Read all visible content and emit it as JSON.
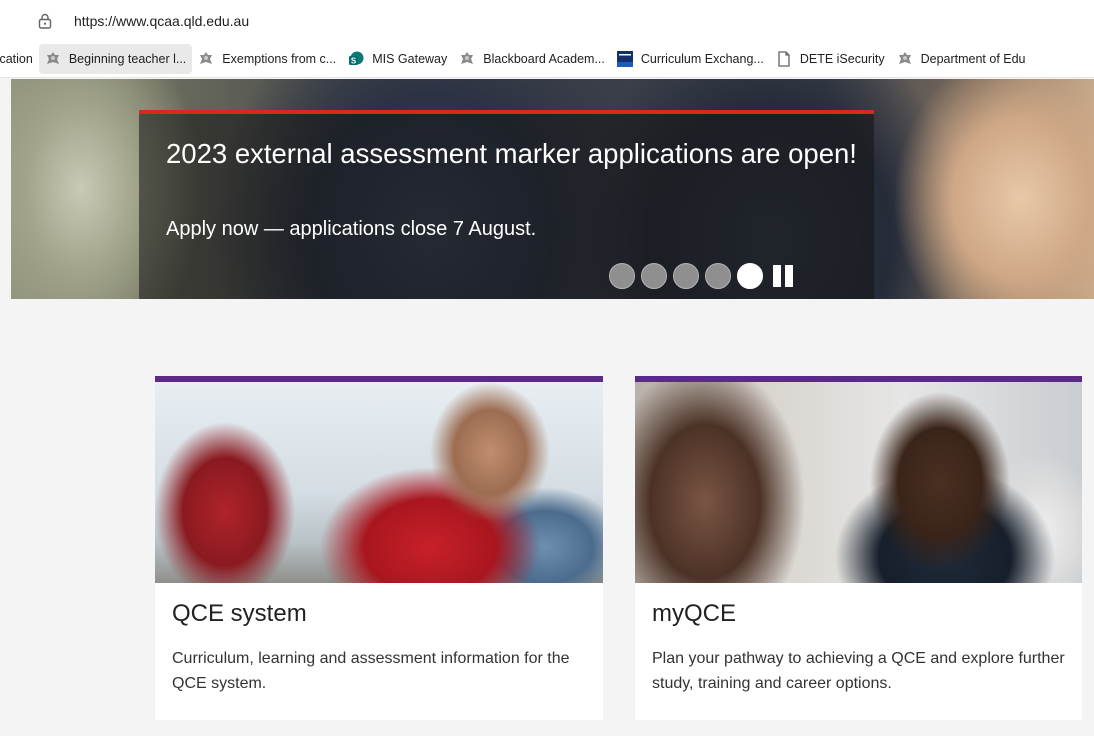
{
  "browser": {
    "url": "https://www.qcaa.qld.edu.au",
    "bookmarks": [
      {
        "label": "ıcation",
        "icon": "none"
      },
      {
        "label": "Beginning teacher l...",
        "icon": "qld-crest-icon",
        "active": true
      },
      {
        "label": "Exemptions from c...",
        "icon": "qld-crest-icon"
      },
      {
        "label": "MIS Gateway",
        "icon": "sharepoint-icon"
      },
      {
        "label": "Blackboard Academ...",
        "icon": "qld-crest-icon"
      },
      {
        "label": "Curriculum Exchang...",
        "icon": "tlp-icon"
      },
      {
        "label": "DETE iSecurity",
        "icon": "page-icon"
      },
      {
        "label": "Department of Edu",
        "icon": "qld-crest-icon"
      }
    ]
  },
  "hero": {
    "title": "2023 external assessment marker applications are open!",
    "subtitle": "Apply now — applications close 7 August.",
    "slide_count": 5,
    "active_slide": 5,
    "accent_color": "#d62a1e"
  },
  "cards": [
    {
      "title": "QCE system",
      "description": "Curriculum, learning and assessment information for the QCE system."
    },
    {
      "title": "myQCE",
      "description": "Plan your pathway to achieving a QCE and explore further study, training and career options."
    }
  ],
  "colors": {
    "card_accent": "#5b2a86",
    "page_background": "#f4f4f4"
  }
}
